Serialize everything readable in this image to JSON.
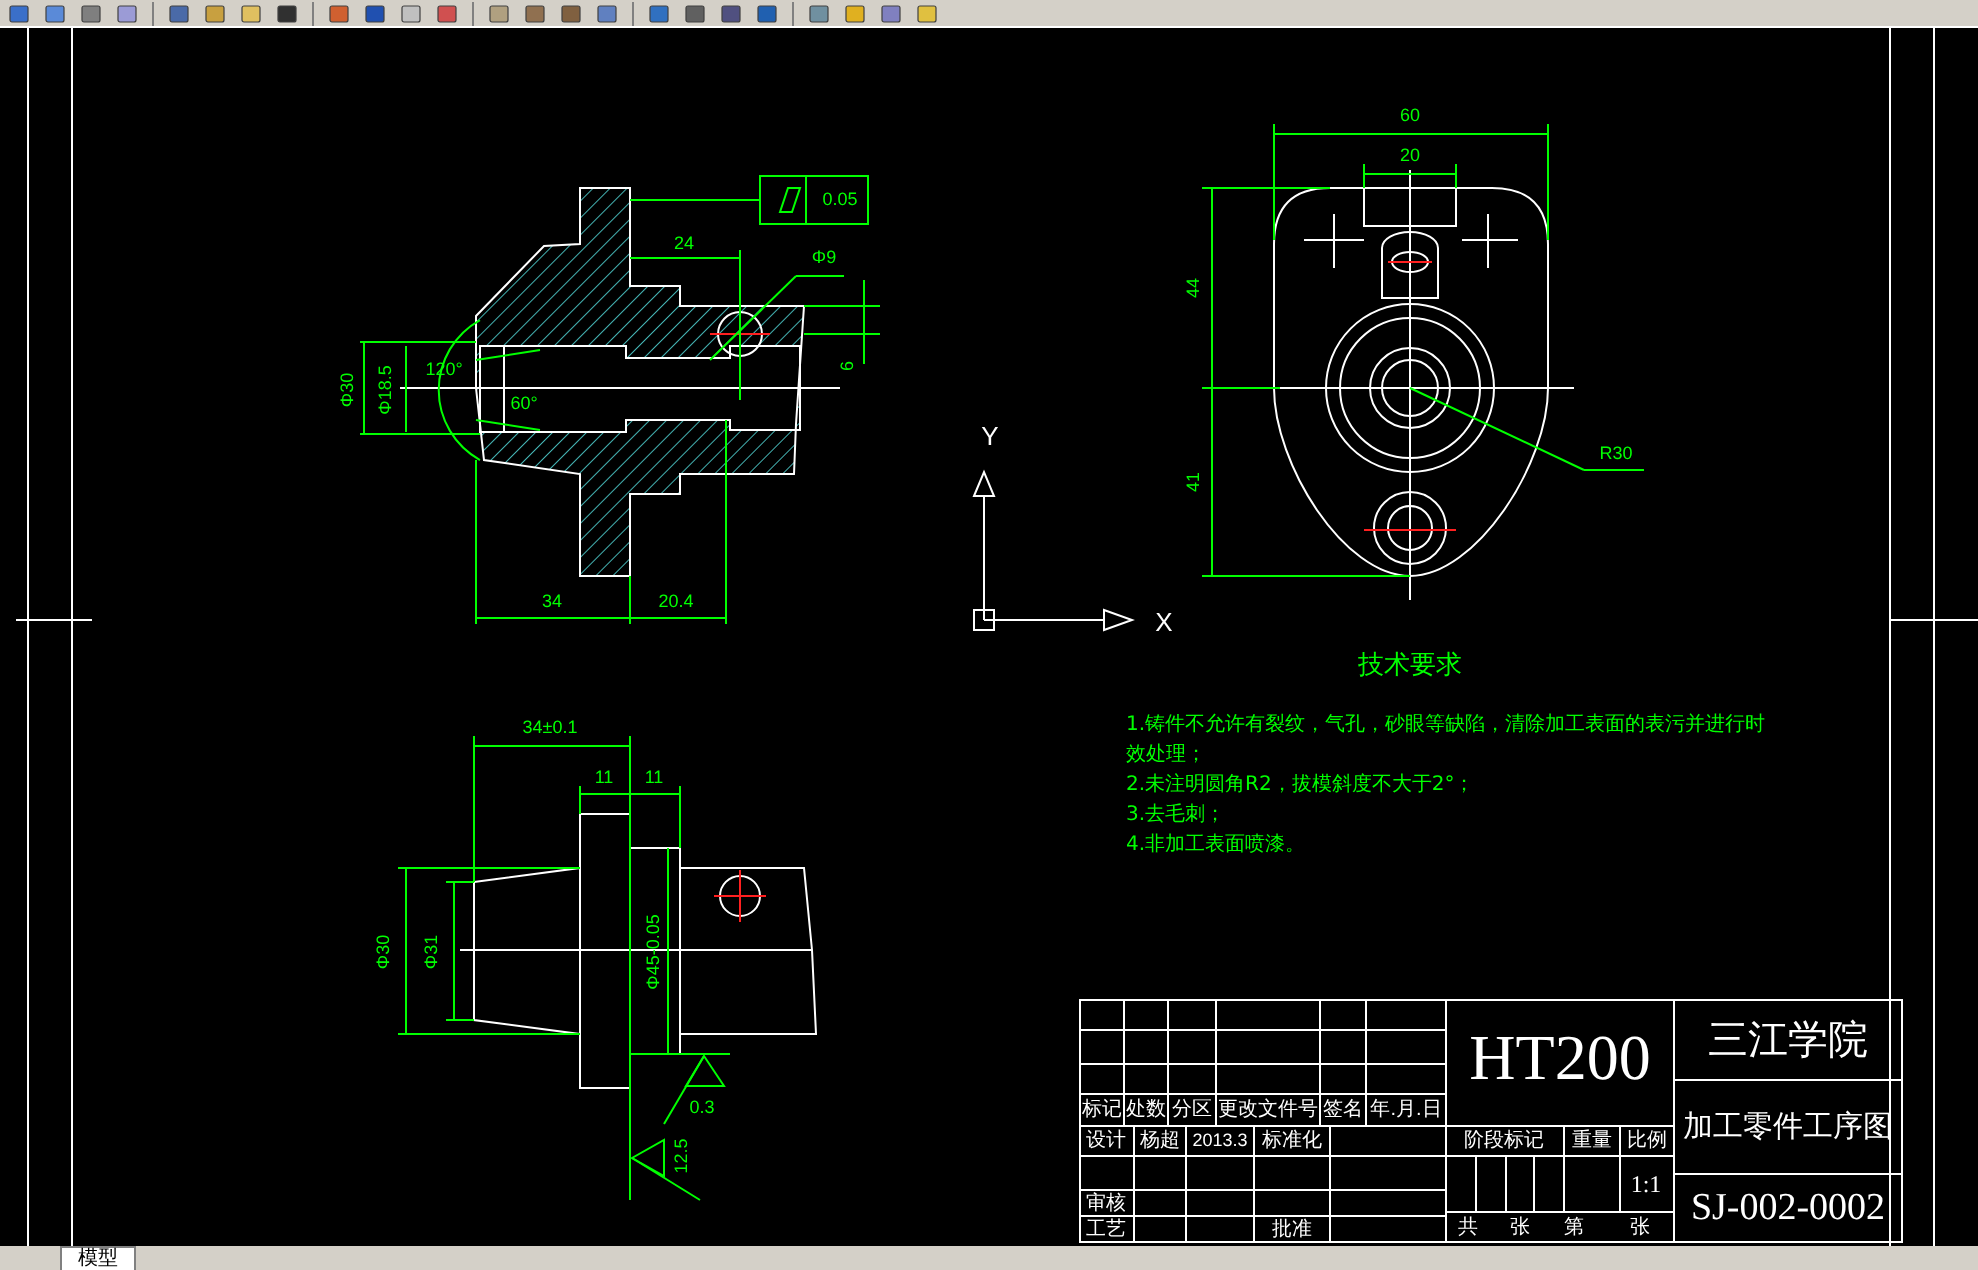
{
  "section_view": {
    "labels": [
      "0.05",
      "24",
      "Φ9",
      "6",
      "Φ30",
      "Φ18.5",
      "120°",
      "60°",
      "34",
      "20.4"
    ]
  },
  "top_view": {
    "labels": [
      "60",
      "20",
      "44",
      "41",
      "R30"
    ]
  },
  "side_view": {
    "labels": [
      "34±0.1",
      "11",
      "11",
      "Φ30",
      "Φ31",
      "Φ45-0.05",
      "0.3",
      "12.5"
    ]
  },
  "axis": {
    "y": "Y",
    "x": "X"
  },
  "requirements": {
    "title": "技术要求",
    "items": [
      "1.铸件不允许有裂纹，气孔，砂眼等缺陷，清除加工表面的表污并进行时效处理；",
      "2.未注明圆角R2，拔模斜度不大于2°；",
      "3.去毛刺；",
      "4.非加工表面喷漆。"
    ]
  },
  "title_block": {
    "material": "HT200",
    "school": "三江学院",
    "drawing_title": "加工零件工序图",
    "drawing_number": "SJ-002-0002",
    "revision_headers": [
      "标记",
      "处数",
      "分区",
      "更改文件号",
      "签名",
      "年.月.日"
    ],
    "design_row": [
      "设计",
      "杨超",
      "2013.3",
      "标准化"
    ],
    "review_label": "审核",
    "process_label": "工艺",
    "approve_label": "批准",
    "stage_headers": [
      "阶段标记",
      "重量",
      "比例"
    ],
    "scale": "1:1",
    "sheet_labels": [
      "共",
      "张",
      "第",
      "张"
    ]
  },
  "tabs": [
    {
      "label": "模型",
      "selected": true
    }
  ]
}
